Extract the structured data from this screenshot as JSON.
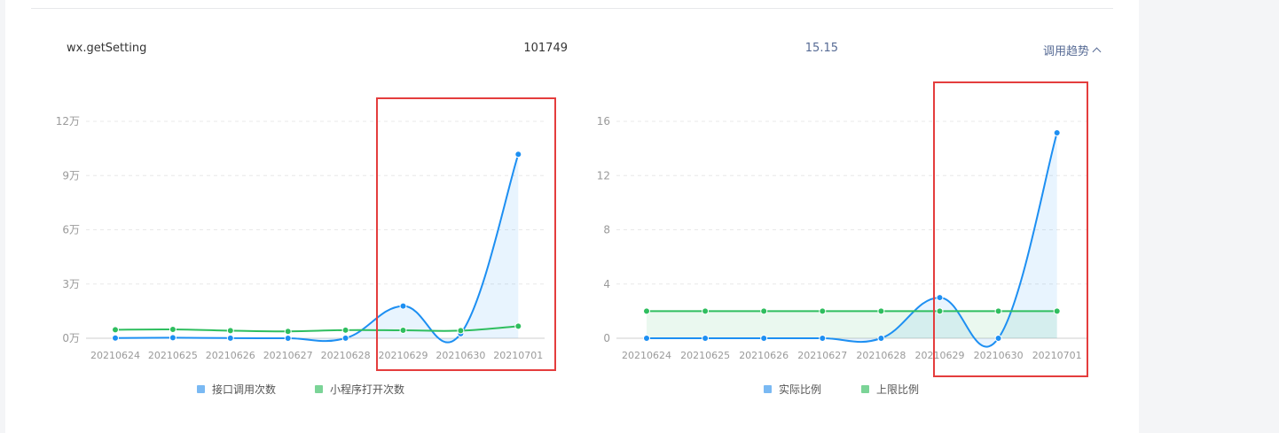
{
  "row": {
    "api_name": "wx.getSetting",
    "call_count": "101749",
    "ratio": "15.15",
    "toggle_label": "调用趋势"
  },
  "colors": {
    "blue": "#1d8ff2",
    "green": "#2fbe5f",
    "blue_legend": "#7ab9f3",
    "green_legend": "#7bd497",
    "highlight": "#e43d3d"
  },
  "chart_data": [
    {
      "type": "line",
      "categories": [
        "20210624",
        "20210625",
        "20210626",
        "20210627",
        "20210628",
        "20210629",
        "20210630",
        "20210701"
      ],
      "yticks": [
        "0万",
        "3万",
        "6万",
        "9万",
        "12万"
      ],
      "ylim": [
        0,
        120000
      ],
      "grid": true,
      "legend_position": "bottom",
      "series": [
        {
          "name": "接口调用次数",
          "color": "#1d8ff2",
          "area": true,
          "values": [
            120,
            300,
            80,
            0,
            50,
            17800,
            2500,
            101749
          ]
        },
        {
          "name": "小程序打开次数",
          "color": "#2fbe5f",
          "area": false,
          "values": [
            4700,
            4900,
            4200,
            3800,
            4500,
            4400,
            4200,
            6700
          ]
        }
      ]
    },
    {
      "type": "line",
      "categories": [
        "20210624",
        "20210625",
        "20210626",
        "20210627",
        "20210628",
        "20210629",
        "20210630",
        "20210701"
      ],
      "yticks": [
        "0",
        "4",
        "8",
        "12",
        "16"
      ],
      "ylim": [
        0,
        16
      ],
      "grid": true,
      "legend_position": "bottom",
      "series": [
        {
          "name": "实际比例",
          "color": "#1d8ff2",
          "area": true,
          "values": [
            0,
            0,
            0,
            0,
            0,
            3,
            0,
            15.15
          ]
        },
        {
          "name": "上限比例",
          "color": "#2fbe5f",
          "area": true,
          "values": [
            2,
            2,
            2,
            2,
            2,
            2,
            2,
            2
          ]
        }
      ]
    }
  ]
}
